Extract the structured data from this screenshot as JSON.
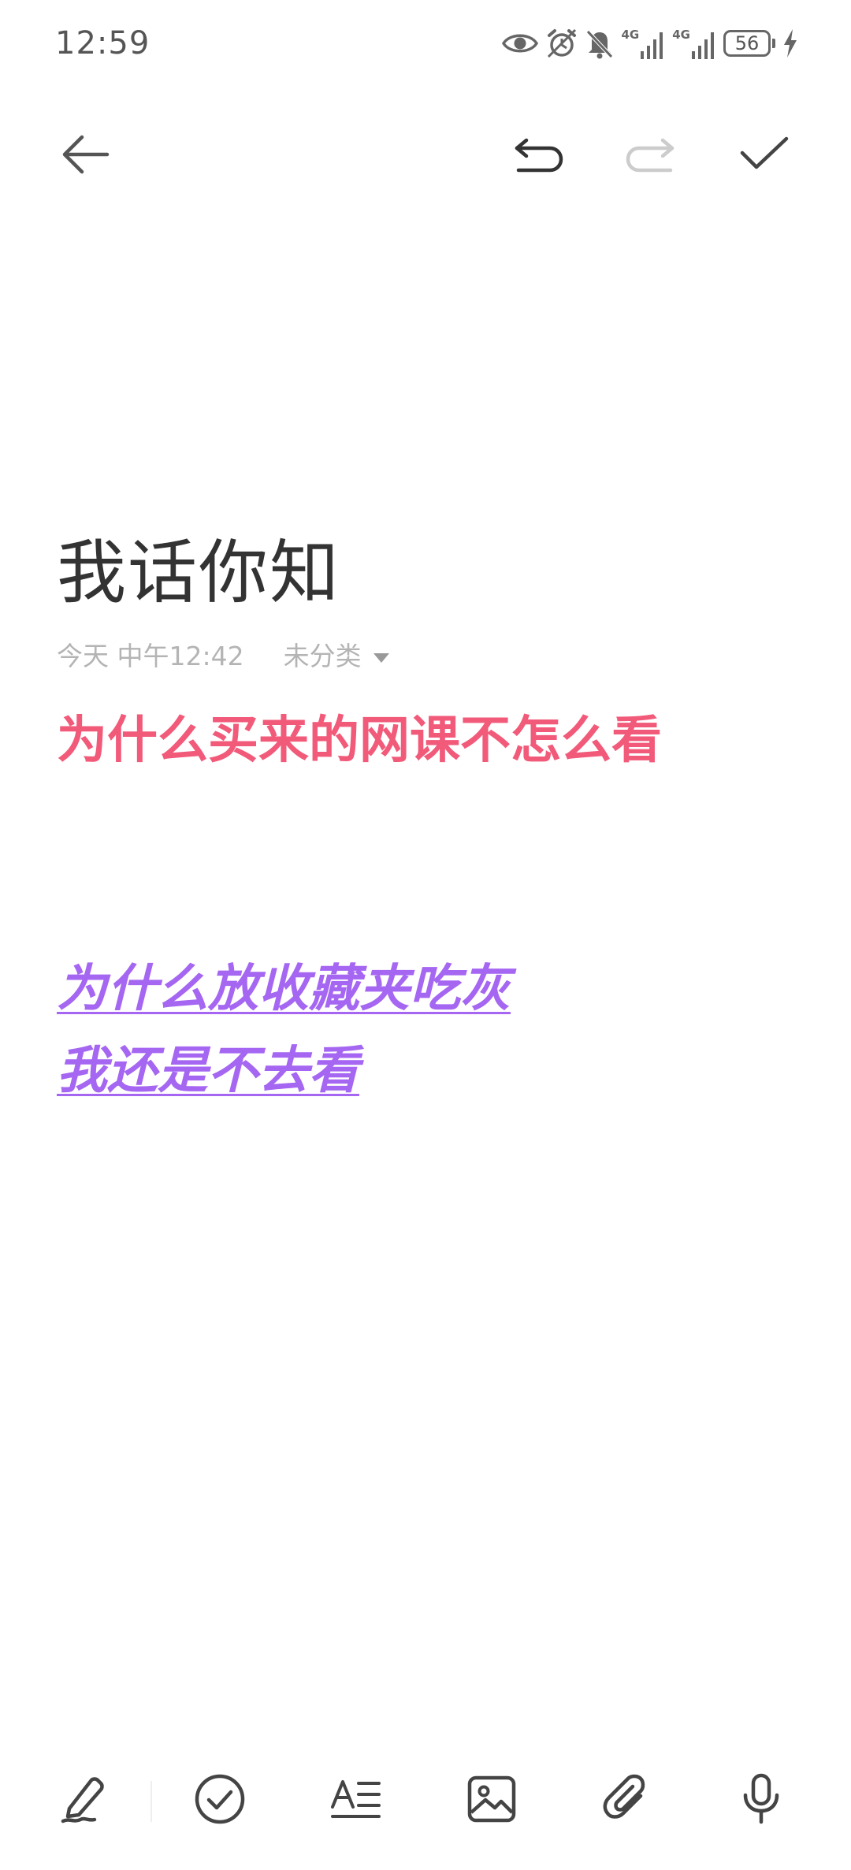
{
  "status_bar": {
    "time": "12:59",
    "icons": [
      "eye-icon",
      "alarm-icon",
      "bell-off-icon",
      "signal-4g-icon",
      "signal-4g-icon",
      "battery-icon",
      "charging-icon"
    ],
    "network_label_1": "4G",
    "network_label_2": "4G",
    "battery_level": "56"
  },
  "toolbar": {
    "icons": [
      "back-arrow-icon",
      "undo-icon",
      "redo-icon",
      "check-icon"
    ],
    "redo_enabled": false
  },
  "note": {
    "title": "我话你知",
    "date": "今天 中午12:42",
    "category": "未分类",
    "lines": [
      {
        "text": "为什么买来的网课不怎么看",
        "color": "#f25a7a",
        "style": "bold"
      },
      {
        "text": "为什么放收藏夹吃灰",
        "color": "#a566f2",
        "style": "bold italic underline"
      },
      {
        "text": "我还是不去看",
        "color": "#a566f2",
        "style": "bold italic underline"
      }
    ]
  },
  "bottom_toolbar": {
    "icons": [
      "pen-icon",
      "checklist-icon",
      "text-format-icon",
      "image-icon",
      "attachment-icon",
      "microphone-icon"
    ]
  },
  "colors": {
    "pink": "#f25a7a",
    "purple": "#a566f2",
    "title": "#333333",
    "meta": "#b4b4b4",
    "icon": "#555555",
    "disabled_icon": "#cccccc"
  }
}
